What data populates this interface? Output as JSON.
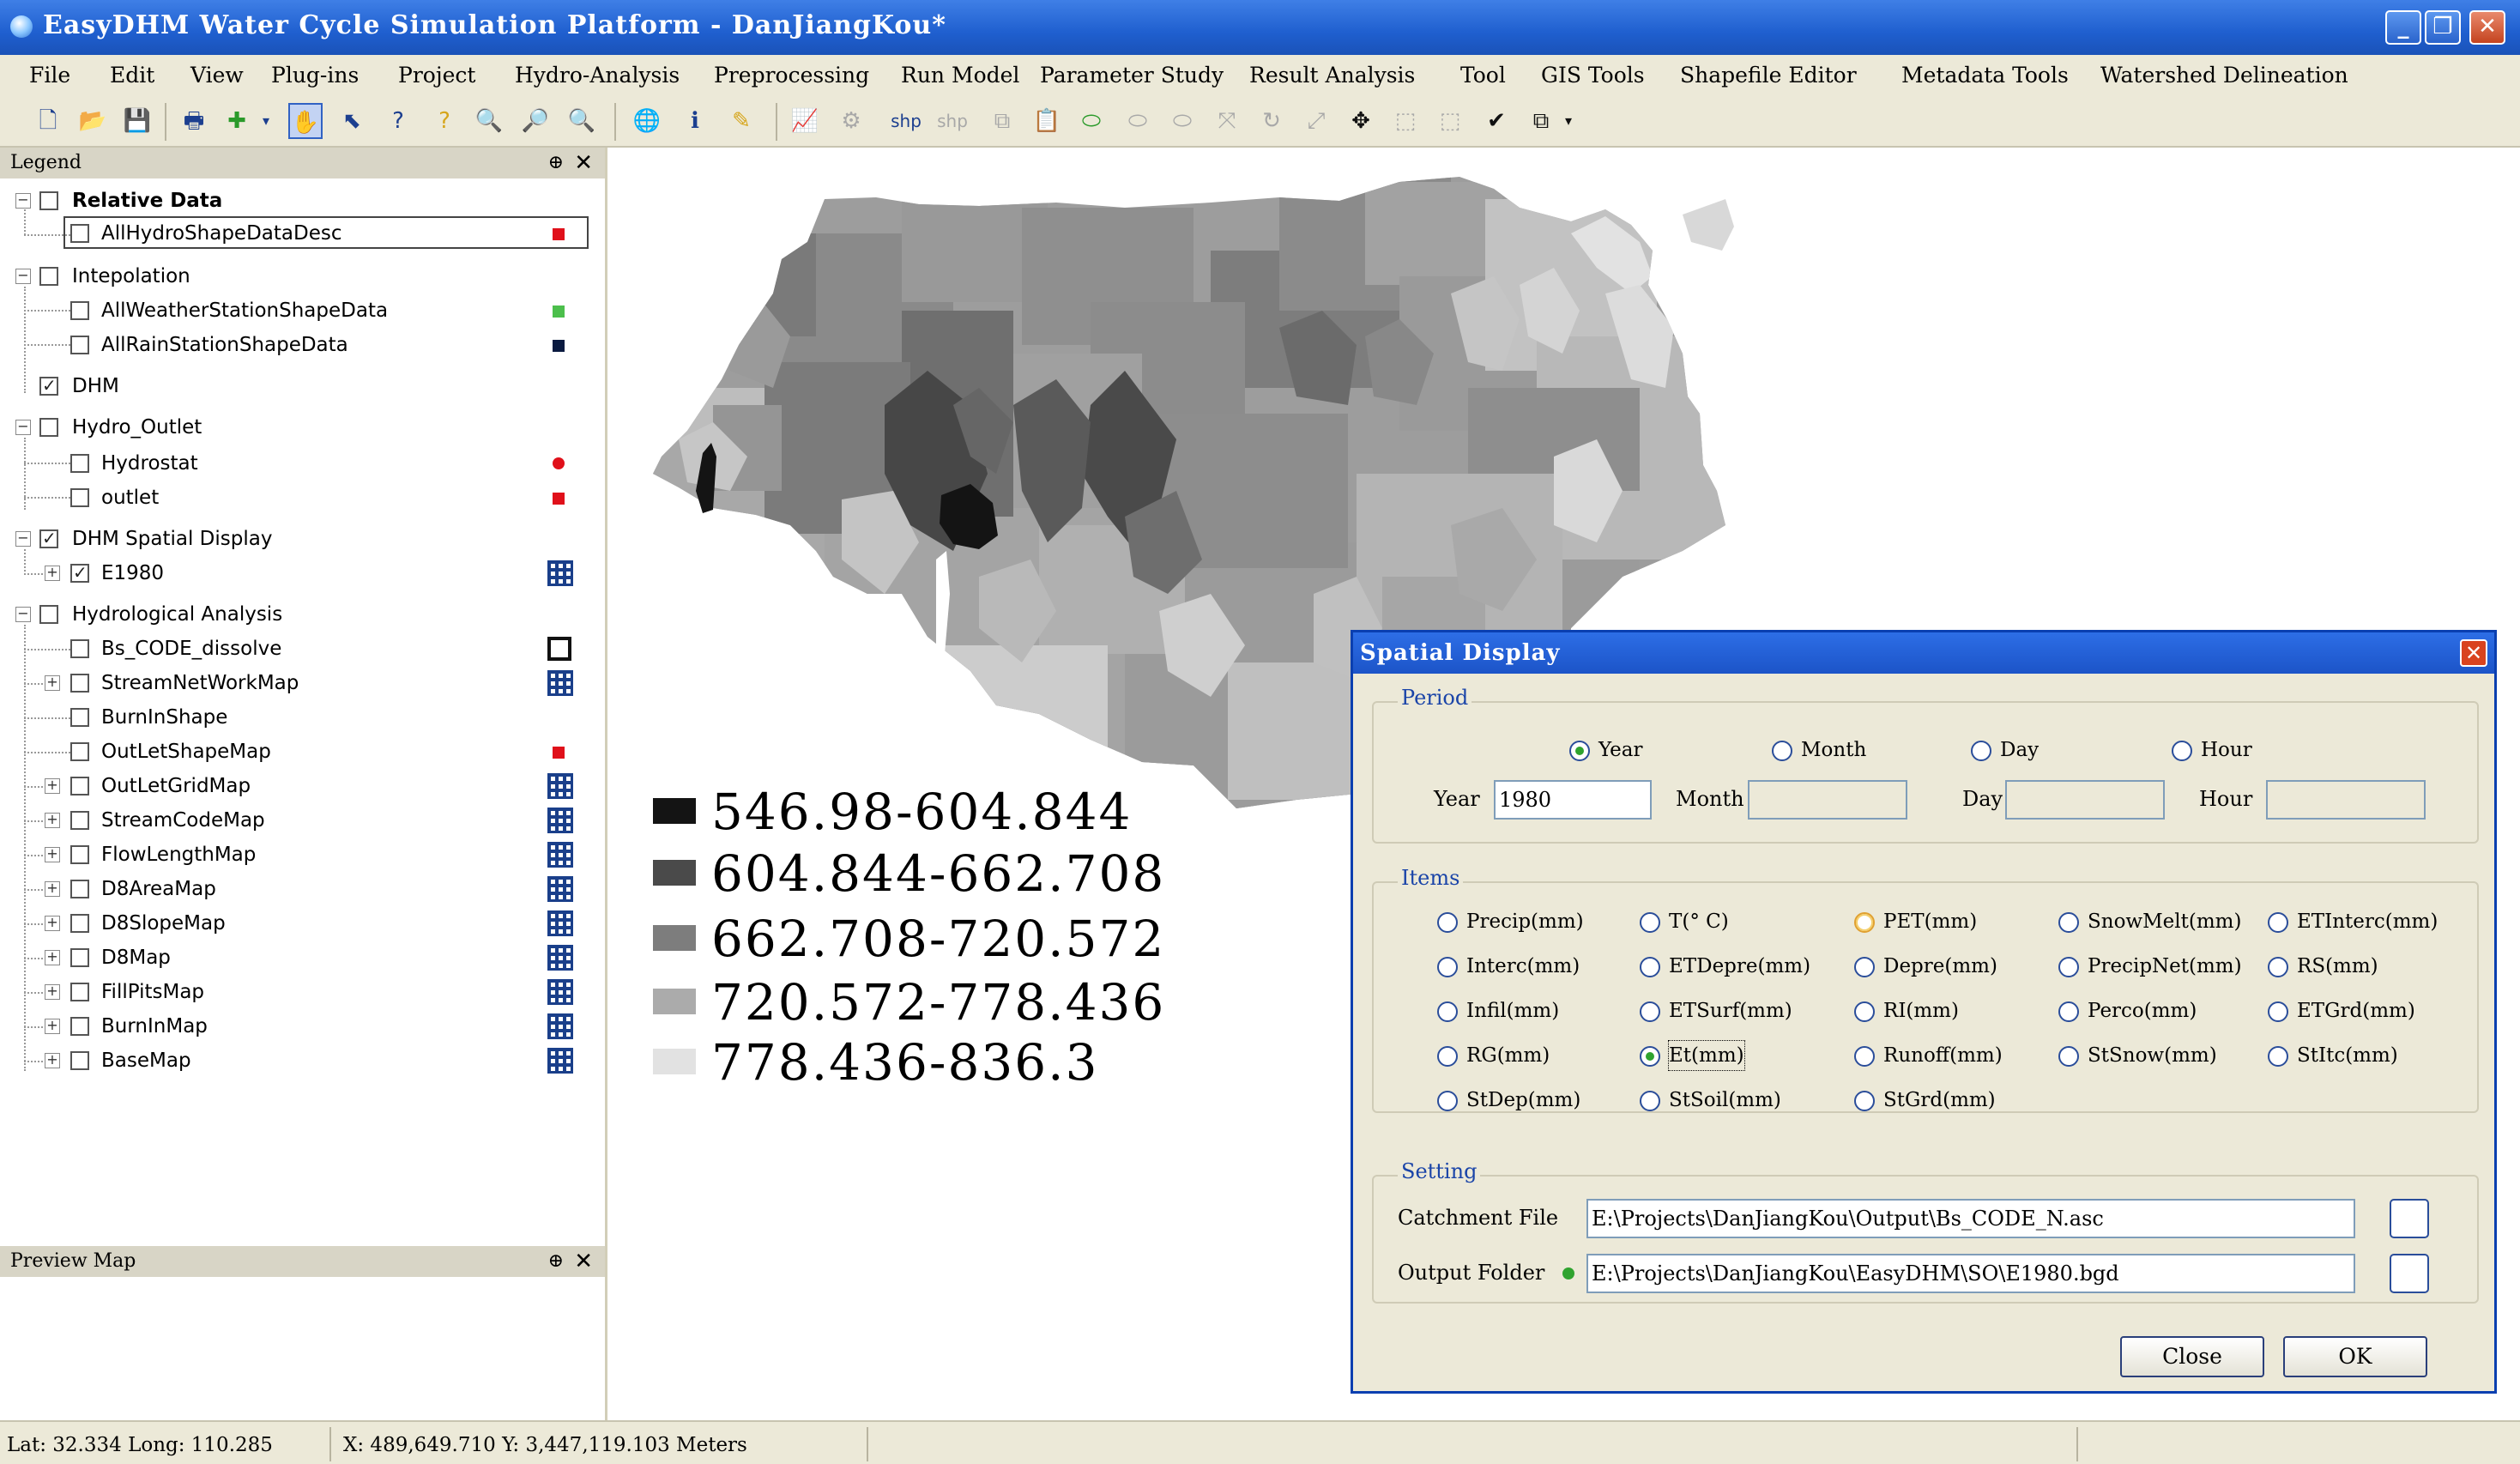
{
  "window": {
    "title": "EasyDHM Water Cycle Simulation Platform  - DanJiangKou*",
    "minimize": "_",
    "restore": "❐",
    "close": "✕"
  },
  "menu": [
    "File",
    "Edit",
    "View",
    "Plug-ins",
    "Project",
    "Hydro-Analysis",
    "Preprocessing",
    "Run Model",
    "Parameter Study",
    "Result Analysis",
    "Tool",
    "GIS Tools",
    "Shapefile Editor",
    "Metadata Tools",
    "Watershed Delineation"
  ],
  "toolbar": {
    "shp1": "shp",
    "shp2": "shp"
  },
  "legend_panel": {
    "title": "Legend",
    "pin": "⊕",
    "close": "✕",
    "groups": [
      {
        "label": "Relative Data",
        "items": [
          {
            "label": "AllHydroShapeDataDesc",
            "color": "#e0101a"
          }
        ]
      },
      {
        "label": "Intepolation",
        "items": [
          {
            "label": "AllWeatherStationShapeData",
            "color": "#4cbf4c"
          },
          {
            "label": "AllRainStationShapeData",
            "color": "#0a1a40"
          }
        ]
      },
      {
        "label": "DHM",
        "items": []
      },
      {
        "label": "Hydro_Outlet",
        "items": [
          {
            "label": "Hydrostat",
            "color": "#e0101a"
          },
          {
            "label": "outlet",
            "color": "#e0101a"
          }
        ]
      },
      {
        "label": "DHM Spatial Display",
        "items": [
          {
            "label": "E1980"
          }
        ]
      },
      {
        "label": "Hydrological Analysis",
        "items": [
          {
            "label": "Bs_CODE_dissolve"
          },
          {
            "label": "StreamNetWorkMap"
          },
          {
            "label": "BurnInShape"
          },
          {
            "label": "OutLetShapeMap",
            "color": "#e0101a"
          },
          {
            "label": "OutLetGridMap"
          },
          {
            "label": "StreamCodeMap"
          },
          {
            "label": "FlowLengthMap"
          },
          {
            "label": "D8AreaMap"
          },
          {
            "label": "D8SlopeMap"
          },
          {
            "label": "D8Map"
          },
          {
            "label": "FillPitsMap"
          },
          {
            "label": "BurnInMap"
          },
          {
            "label": "BaseMap"
          }
        ]
      }
    ]
  },
  "preview_panel": {
    "title": "Preview Map",
    "pin": "⊕",
    "close": "✕"
  },
  "map_legend": [
    {
      "label": "546.98-604.844",
      "color": "#141414"
    },
    {
      "label": "604.844-662.708",
      "color": "#4a4a4a"
    },
    {
      "label": "662.708-720.572",
      "color": "#7d7d7d"
    },
    {
      "label": "720.572-778.436",
      "color": "#ababab"
    },
    {
      "label": "778.436-836.3",
      "color": "#e2e2e2"
    }
  ],
  "dialog": {
    "title": "Spatial Display",
    "close": "✕",
    "period": {
      "title": "Period",
      "options": [
        "Year",
        "Month",
        "Day",
        "Hour"
      ],
      "selected": "Year",
      "fields": [
        {
          "label": "Year",
          "value": "1980"
        },
        {
          "label": "Month",
          "value": ""
        },
        {
          "label": "Day",
          "value": ""
        },
        {
          "label": "Hour",
          "value": ""
        }
      ]
    },
    "items": {
      "title": "Items",
      "options": [
        "Precip(mm)",
        "T(° C)",
        "PET(mm)",
        "SnowMelt(mm)",
        "ETInterc(mm)",
        "Interc(mm)",
        "ETDepre(mm)",
        "Depre(mm)",
        "PrecipNet(mm)",
        "RS(mm)",
        "Infil(mm)",
        "ETSurf(mm)",
        "RI(mm)",
        "Perco(mm)",
        "ETGrd(mm)",
        "RG(mm)",
        "Et(mm)",
        "Runoff(mm)",
        "StSnow(mm)",
        "StItc(mm)",
        "StDep(mm)",
        "StSoil(mm)",
        "StGrd(mm)"
      ],
      "selected": "Et(mm)"
    },
    "setting": {
      "title": "Setting",
      "catchment_label": "Catchment File",
      "catchment_value": "E:\\Projects\\DanJiangKou\\Output\\Bs_CODE_N.asc",
      "output_label": "Output Folder",
      "output_value": "E:\\Projects\\DanJiangKou\\EasyDHM\\SO\\E1980.bgd"
    },
    "buttons": {
      "close": "Close",
      "ok": "OK"
    }
  },
  "statusbar": {
    "latlong": "Lat: 32.334 Long: 110.285",
    "xy": "X: 489,649.710 Y: 3,447,119.103 Meters"
  }
}
